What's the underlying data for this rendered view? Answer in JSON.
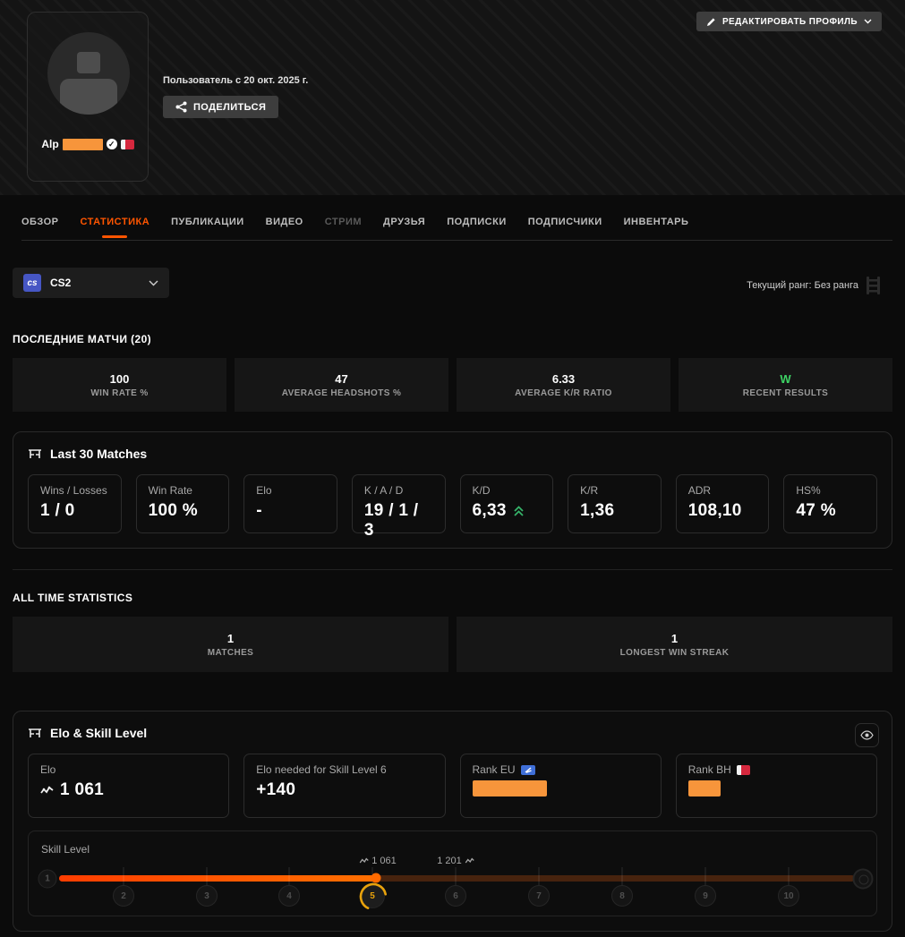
{
  "header": {
    "edit_label": "РЕДАКТИРОВАТЬ ПРОФИЛЬ",
    "member_since": "Пользователь с 20 окт. 2025 г.",
    "share_label": "ПОДЕЛИТЬСЯ",
    "username_prefix": "Alp"
  },
  "tabs": [
    {
      "label": "ОБЗОР"
    },
    {
      "label": "СТАТИСТИКА"
    },
    {
      "label": "ПУБЛИКАЦИИ"
    },
    {
      "label": "ВИДЕО"
    },
    {
      "label": "СТРИМ"
    },
    {
      "label": "ДРУЗЬЯ"
    },
    {
      "label": "ПОДПИСКИ"
    },
    {
      "label": "ПОДПИСЧИКИ"
    },
    {
      "label": "ИНВЕНТАРЬ"
    }
  ],
  "game": {
    "selected": "CS2",
    "badge": "cs"
  },
  "rank": {
    "text": "Текущий ранг: Без ранга"
  },
  "recent": {
    "title": "ПОСЛЕДНИЕ МАТЧИ (20)",
    "tiles": [
      {
        "value": "100",
        "label": "WIN RATE %"
      },
      {
        "value": "47",
        "label": "AVERAGE HEADSHOTS %"
      },
      {
        "value": "6.33",
        "label": "AVERAGE K/R RATIO"
      },
      {
        "value": "W",
        "label": "RECENT RESULTS"
      }
    ]
  },
  "last30": {
    "title": "Last 30 Matches",
    "cards": [
      {
        "label": "Wins / Losses",
        "value": "1 / 0"
      },
      {
        "label": "Win Rate",
        "value": "100 %"
      },
      {
        "label": "Elo",
        "value": "-"
      },
      {
        "label": "K / A / D",
        "value": "19 / 1 / 3"
      },
      {
        "label": "K/D",
        "value": "6,33"
      },
      {
        "label": "K/R",
        "value": "1,36"
      },
      {
        "label": "ADR",
        "value": "108,10"
      },
      {
        "label": "HS%",
        "value": "47 %"
      }
    ]
  },
  "all_time": {
    "title": "ALL TIME STATISTICS",
    "tiles": [
      {
        "value": "1",
        "label": "MATCHES"
      },
      {
        "value": "1",
        "label": "LONGEST WIN STREAK"
      }
    ]
  },
  "elo_panel": {
    "title": "Elo & Skill Level",
    "cards": [
      {
        "label": "Elo",
        "value": "1 061"
      },
      {
        "label": "Elo needed for Skill Level 6",
        "value": "+140"
      },
      {
        "label": "Rank EU"
      },
      {
        "label": "Rank BH"
      }
    ],
    "skill": {
      "label": "Skill Level",
      "current_elo": "1 061",
      "next_threshold": "1 201",
      "levels": [
        "1",
        "2",
        "3",
        "4",
        "5",
        "6",
        "7",
        "8",
        "9",
        "10"
      ]
    }
  },
  "colors": {
    "accent": "#ff5500",
    "green": "#3dd264",
    "redact_orange": "#f7953b",
    "progress_orange": "#ff6a00"
  }
}
